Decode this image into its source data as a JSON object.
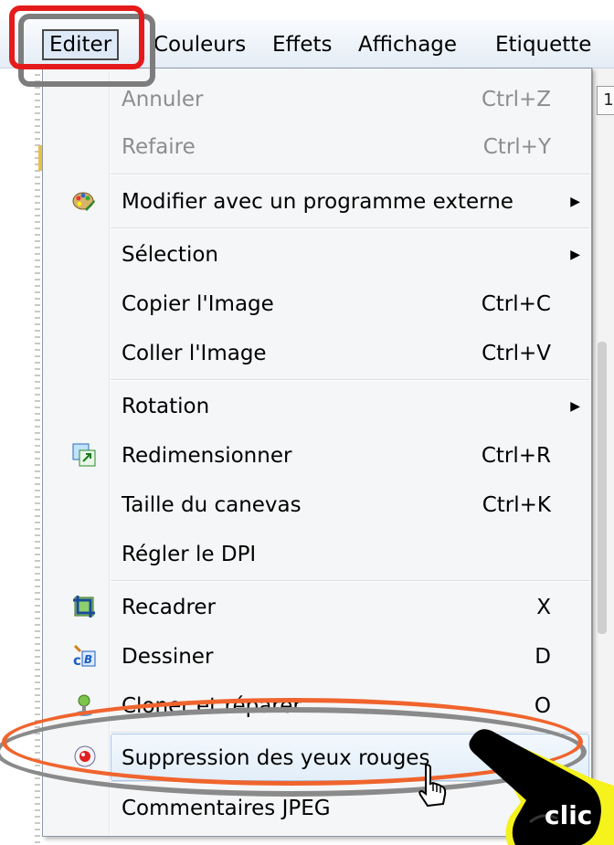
{
  "menubar": {
    "items": [
      "Editer",
      "Couleurs",
      "Effets",
      "Affichage",
      "Etiquette"
    ]
  },
  "right_panel": {
    "button_label": "1"
  },
  "menu": {
    "items": [
      {
        "label": "Annuler",
        "shortcut": "Ctrl+Z",
        "disabled": true
      },
      {
        "label": "Refaire",
        "shortcut": "Ctrl+Y",
        "disabled": true
      },
      {
        "label": "Modifier avec un programme externe",
        "icon": "palette-icon",
        "submenu": true
      },
      {
        "label": "Sélection",
        "submenu": true
      },
      {
        "label": "Copier l'Image",
        "shortcut": "Ctrl+C"
      },
      {
        "label": "Coller l'Image",
        "shortcut": "Ctrl+V"
      },
      {
        "label": "Rotation",
        "submenu": true
      },
      {
        "label": "Redimensionner",
        "shortcut": "Ctrl+R",
        "icon": "resize-icon"
      },
      {
        "label": "Taille du canevas",
        "shortcut": "Ctrl+K"
      },
      {
        "label": "Régler le DPI"
      },
      {
        "label": "Recadrer",
        "shortcut": "X",
        "icon": "crop-icon"
      },
      {
        "label": "Dessiner",
        "shortcut": "D",
        "icon": "draw-icon"
      },
      {
        "label": "Cloner et réparer",
        "shortcut": "O",
        "icon": "clone-icon"
      },
      {
        "label": "Suppression des yeux rouges",
        "icon": "red-eye-icon",
        "highlighted": true
      },
      {
        "label": "Commentaires JPEG"
      }
    ],
    "submenu_glyph": "▶"
  },
  "annotation": {
    "click_label": "clic"
  },
  "colors": {
    "annotation_red": "#e51b1b",
    "annotation_orange": "#f0642d",
    "annotation_grey": "#7d7d7d",
    "hand_yellow": "#f5f21c",
    "highlight_border": "#a9c8ea"
  }
}
